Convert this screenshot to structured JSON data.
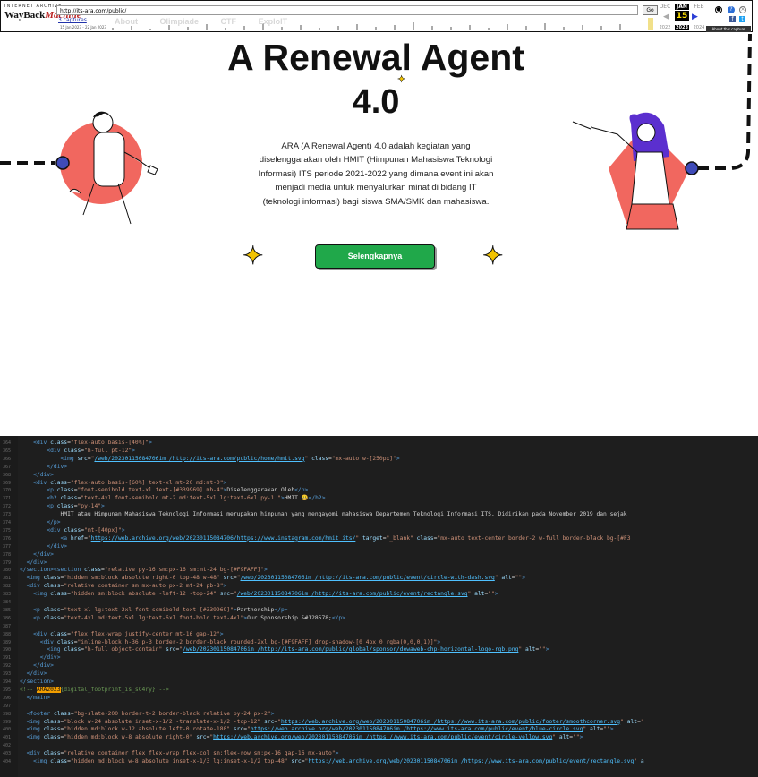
{
  "wayback": {
    "small_title": "INTERNET ARCHIVE",
    "logo_a": "WayBack",
    "logo_b": "Machine",
    "url": "http://its-ara.com/public/",
    "go_label": "Go",
    "captures_label": "3 captures",
    "date_range": "15 Jan 2023 - 22 Jan 2023",
    "months": [
      "DEC",
      "JAN",
      "FEB"
    ],
    "day": "15",
    "years": [
      "2022",
      "2023",
      "2024"
    ],
    "about_label": "About this capture",
    "prev_glyph": "◀",
    "next_glyph": "▶"
  },
  "site_nav": {
    "items": [
      "About",
      "Olimpiade",
      "CTF",
      "ExploIT"
    ]
  },
  "hero": {
    "title": "A Renewal Agent",
    "version": "4.0",
    "description": "ARA (A Renewal Agent) 4.0 adalah kegiatan yang diselenggarakan oleh HMIT (Himpunan Mahasiswa Teknologi Informasi) ITS periode 2021-2022 yang dimana event ini akan menjadi media untuk menyalurkan minat di bidang IT (teknologi informasi) bagi siswa SMA/SMK dan mahasiswa.",
    "cta_label": "Selengkapnya"
  },
  "colors": {
    "accent_red": "#f1675f",
    "cta_green": "#20a84a",
    "sparkle": "#f2c300",
    "dot_blue": "#3f4bb8",
    "purple_hair": "#5b2fcf"
  },
  "code": {
    "lines": [
      {
        "n": "364",
        "html": "    <span class=\"tag\">&lt;div</span> <span class=\"attr\">class</span>=<span class=\"str\">\"flex-auto basis-[40%]\"</span><span class=\"tag\">&gt;</span>"
      },
      {
        "n": "365",
        "html": "        <span class=\"tag\">&lt;div</span> <span class=\"attr\">class</span>=<span class=\"str\">\"h-full pt-12\"</span><span class=\"tag\">&gt;</span>"
      },
      {
        "n": "366",
        "html": "            <span class=\"tag\">&lt;img</span> <span class=\"attr\">src</span>=<span class=\"str\">\"<span class=\"url\">/web/20230115084706im_/http://its-ara.com/public/home/hmit.svg</span>\"</span> <span class=\"attr\">class</span>=<span class=\"str\">\"mx-auto w-[250px]\"</span><span class=\"tag\">&gt;</span>"
      },
      {
        "n": "367",
        "html": "        <span class=\"tag\">&lt;/div&gt;</span>"
      },
      {
        "n": "368",
        "html": "    <span class=\"tag\">&lt;/div&gt;</span>"
      },
      {
        "n": "369",
        "html": "    <span class=\"tag\">&lt;div</span> <span class=\"attr\">class</span>=<span class=\"str\">\"flex-auto basis-[60%] text-xl mt-20 md:mt-0\"</span><span class=\"tag\">&gt;</span>"
      },
      {
        "n": "370",
        "html": "        <span class=\"tag\">&lt;p</span> <span class=\"attr\">class</span>=<span class=\"str\">\"font-semibold text-xl text-[#339969] mb-4\"</span><span class=\"tag\">&gt;</span>Diselenggarakan Oleh<span class=\"tag\">&lt;/p&gt;</span>"
      },
      {
        "n": "371",
        "html": "        <span class=\"tag\">&lt;h2</span> <span class=\"attr\">class</span>=<span class=\"str\">\"text-4xl font-semibold mt-2 md:text-5xl lg:text-6xl py-1 \"</span><span class=\"tag\">&gt;</span>HMIT 😀<span class=\"tag\">&lt;/h2&gt;</span>"
      },
      {
        "n": "372",
        "html": "        <span class=\"tag\">&lt;p</span> <span class=\"attr\">class</span>=<span class=\"str\">\"py-14\"</span><span class=\"tag\">&gt;</span>"
      },
      {
        "n": "373",
        "html": "            HMIT atau Himpunan Mahasiswa Teknologi Informasi merupakan himpunan yang mengayomi mahasiswa Departemen Teknologi Informasi ITS. Didirikan pada November 2019 dan sejak"
      },
      {
        "n": "374",
        "html": "        <span class=\"tag\">&lt;/p&gt;</span>"
      },
      {
        "n": "375",
        "html": "        <span class=\"tag\">&lt;div</span> <span class=\"attr\">class</span>=<span class=\"str\">\"mt-[40px]\"</span><span class=\"tag\">&gt;</span>"
      },
      {
        "n": "376",
        "html": "            <span class=\"tag\">&lt;a</span> <span class=\"attr\">href</span>=<span class=\"str\">\"<span class=\"url\">https://web.archive.org/web/20230115084706/https://www.instagram.com/hmit_its/</span>\"</span> <span class=\"attr\">target</span>=<span class=\"str\">\"_blank\"</span> <span class=\"attr\">class</span>=<span class=\"str\">\"mx-auto text-center border-2 w-full border-black bg-[#F3</span>"
      },
      {
        "n": "377",
        "html": "        <span class=\"tag\">&lt;/div&gt;</span>"
      },
      {
        "n": "378",
        "html": "    <span class=\"tag\">&lt;/div&gt;</span>"
      },
      {
        "n": "379",
        "html": "  <span class=\"tag\">&lt;/div&gt;</span>"
      },
      {
        "n": "380",
        "html": "<span class=\"tag\">&lt;/section&gt;&lt;section</span> <span class=\"attr\">class</span>=<span class=\"str\">\"relative py-16 sm:px-16 sm:mt-24 bg-[#F9FAFF]\"</span><span class=\"tag\">&gt;</span>"
      },
      {
        "n": "381",
        "html": "  <span class=\"tag\">&lt;img</span> <span class=\"attr\">class</span>=<span class=\"str\">\"hidden sm:block absolute right-0 top-48 w-48\"</span> <span class=\"attr\">src</span>=<span class=\"str\">\"<span class=\"url\">/web/20230115084706im_/http://its-ara.com/public/event/circle-with-dash.svg</span>\"</span> <span class=\"attr\">alt</span>=<span class=\"str\">\"\"</span><span class=\"tag\">&gt;</span>"
      },
      {
        "n": "382",
        "html": "  <span class=\"tag\">&lt;div</span> <span class=\"attr\">class</span>=<span class=\"str\">\"relative container sm mx-auto px-2 mt-24 pb-8\"</span><span class=\"tag\">&gt;</span>"
      },
      {
        "n": "383",
        "html": "    <span class=\"tag\">&lt;img</span> <span class=\"attr\">class</span>=<span class=\"str\">\"hidden sm:block absolute -left-12 -top-24\"</span> <span class=\"attr\">src</span>=<span class=\"str\">\"<span class=\"url\">/web/20230115084706im_/http://its-ara.com/public/event/rectangle.svg</span>\"</span> <span class=\"attr\">alt</span>=<span class=\"str\">\"\"</span><span class=\"tag\">&gt;</span>"
      },
      {
        "n": "384",
        "html": ""
      },
      {
        "n": "385",
        "html": "    <span class=\"tag\">&lt;p</span> <span class=\"attr\">class</span>=<span class=\"str\">\"text-xl lg:text-2xl font-semibold text-[#339969]\"</span><span class=\"tag\">&gt;</span>Partnership<span class=\"tag\">&lt;/p&gt;</span>"
      },
      {
        "n": "386",
        "html": "    <span class=\"tag\">&lt;p</span> <span class=\"attr\">class</span>=<span class=\"str\">\"text-4xl md:text-5xl lg:text-6xl font-bold text-4xl\"</span><span class=\"tag\">&gt;</span>Our Sponsorship &amp;#128578;<span class=\"tag\">&lt;/p&gt;</span>"
      },
      {
        "n": "387",
        "html": ""
      },
      {
        "n": "388",
        "html": "    <span class=\"tag\">&lt;div</span> <span class=\"attr\">class</span>=<span class=\"str\">\"flex flex-wrap justify-center mt-16 gap-12\"</span><span class=\"tag\">&gt;</span>"
      },
      {
        "n": "389",
        "html": "      <span class=\"tag\">&lt;div</span> <span class=\"attr\">class</span>=<span class=\"str\">\"inline-block h-36 p-3 border-2 border-black rounded-2xl bg-[#F9FAFF] drop-shadow-[0_4px_0_rgba(0,0,0,1)]\"</span><span class=\"tag\">&gt;</span>"
      },
      {
        "n": "390",
        "html": "        <span class=\"tag\">&lt;img</span> <span class=\"attr\">class</span>=<span class=\"str\">\"h-full object-contain\"</span> <span class=\"attr\">src</span>=<span class=\"str\">\"<span class=\"url\">/web/20230115084706im_/http://its-ara.com/public/global/sponsor/dewaweb-chp-horizontal-logo-rgb.png</span>\"</span> <span class=\"attr\">alt</span>=<span class=\"str\">\"\"</span><span class=\"tag\">&gt;</span>"
      },
      {
        "n": "391",
        "html": "      <span class=\"tag\">&lt;/div&gt;</span>"
      },
      {
        "n": "392",
        "html": "    <span class=\"tag\">&lt;/div&gt;</span>"
      },
      {
        "n": "393",
        "html": "  <span class=\"tag\">&lt;/div&gt;</span>"
      },
      {
        "n": "394",
        "html": "<span class=\"tag\">&lt;/section&gt;</span>"
      },
      {
        "n": "395",
        "html": "<span class=\"cmt\">&lt;!-- <span class=\"hl\">ARA2023</span>{digital_footprint_is_sC4ry} --&gt;</span>"
      },
      {
        "n": "396",
        "html": "  <span class=\"tag\">&lt;/main&gt;</span>"
      },
      {
        "n": "397",
        "html": ""
      },
      {
        "n": "398",
        "html": "  <span class=\"tag\">&lt;footer</span> <span class=\"attr\">class</span>=<span class=\"str\">\"bg-slate-200 border-t-2 border-black relative py-24 px-2\"</span><span class=\"tag\">&gt;</span>"
      },
      {
        "n": "399",
        "html": "  <span class=\"tag\">&lt;img</span> <span class=\"attr\">class</span>=<span class=\"str\">\"block w-24 absolute inset-x-1/2 -translate-x-1/2 -top-12\"</span> <span class=\"attr\">src</span>=<span class=\"str\">\"<span class=\"url\">https://web.archive.org/web/20230115084706im_/https://www.its-ara.com/public/footer/smoothcorner.svg</span>\"</span> <span class=\"attr\">alt</span>=<span class=\"str\">\"</span>"
      },
      {
        "n": "400",
        "html": "  <span class=\"tag\">&lt;img</span> <span class=\"attr\">class</span>=<span class=\"str\">\"hidden md:block w-12 absolute left-0 rotate-180\"</span> <span class=\"attr\">src</span>=<span class=\"str\">\"<span class=\"url\">https://web.archive.org/web/20230115084706im_/https://www.its-ara.com/public/event/blue-circle.svg</span>\"</span> <span class=\"attr\">alt</span>=<span class=\"str\">\"\"</span><span class=\"tag\">&gt;</span>"
      },
      {
        "n": "401",
        "html": "  <span class=\"tag\">&lt;img</span> <span class=\"attr\">class</span>=<span class=\"str\">\"hidden md:block w-8 absolute right-0\"</span> <span class=\"attr\">src</span>=<span class=\"str\">\"<span class=\"url\">https://web.archive.org/web/20230115084706im_/https://www.its-ara.com/public/event/circle-yellow.svg</span>\"</span> <span class=\"attr\">alt</span>=<span class=\"str\">\"\"</span><span class=\"tag\">&gt;</span>"
      },
      {
        "n": "402",
        "html": ""
      },
      {
        "n": "403",
        "html": "  <span class=\"tag\">&lt;div</span> <span class=\"attr\">class</span>=<span class=\"str\">\"relative container flex flex-wrap flex-col sm:flex-row sm:px-16 gap-16 mx-auto\"</span><span class=\"tag\">&gt;</span>"
      },
      {
        "n": "404",
        "html": "    <span class=\"tag\">&lt;img</span> <span class=\"attr\">class</span>=<span class=\"str\">\"hidden md:block w-8 absolute inset-x-1/3 lg:inset-x-1/2 top-48\"</span> <span class=\"attr\">src</span>=<span class=\"str\">\"<span class=\"url\">https://web.archive.org/web/20230115084706im_/https://www.its-ara.com/public/event/rectangle.svg</span>\"</span> <span class=\"attr\">a</span>"
      }
    ]
  }
}
